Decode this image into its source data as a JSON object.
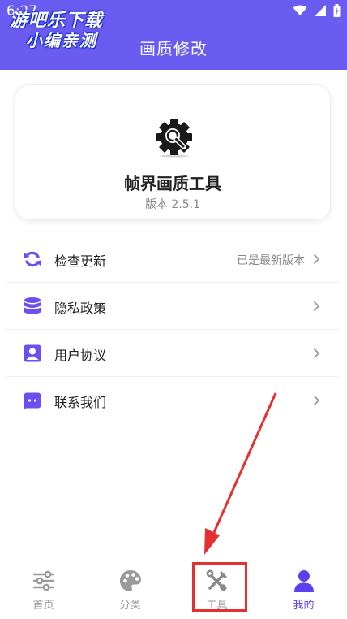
{
  "status_bar": {
    "time": "6:27"
  },
  "watermark": {
    "line1": "游吧乐下载",
    "line2": "小编亲测"
  },
  "header": {
    "title": "画质修改"
  },
  "app": {
    "name": "帧界画质工具",
    "version": "版本 2.5.1"
  },
  "menu": {
    "items": [
      {
        "label": "检查更新",
        "value": "已是最新版本",
        "icon": "refresh-icon"
      },
      {
        "label": "隐私政策",
        "value": "",
        "icon": "database-icon"
      },
      {
        "label": "用户协议",
        "value": "",
        "icon": "user-card-icon"
      },
      {
        "label": "联系我们",
        "value": "",
        "icon": "chat-icon"
      }
    ]
  },
  "tabbar": {
    "items": [
      {
        "label": "首页",
        "icon": "sliders-icon",
        "active": false
      },
      {
        "label": "分类",
        "icon": "palette-icon",
        "active": false
      },
      {
        "label": "工具",
        "icon": "tools-icon",
        "active": false
      },
      {
        "label": "我的",
        "icon": "person-icon",
        "active": true
      }
    ]
  },
  "colors": {
    "header_bg": "#6a5cf0",
    "accent": "#5b3ff0",
    "icon_purple": "#6d4ef0",
    "annotation_red": "#e53030"
  }
}
